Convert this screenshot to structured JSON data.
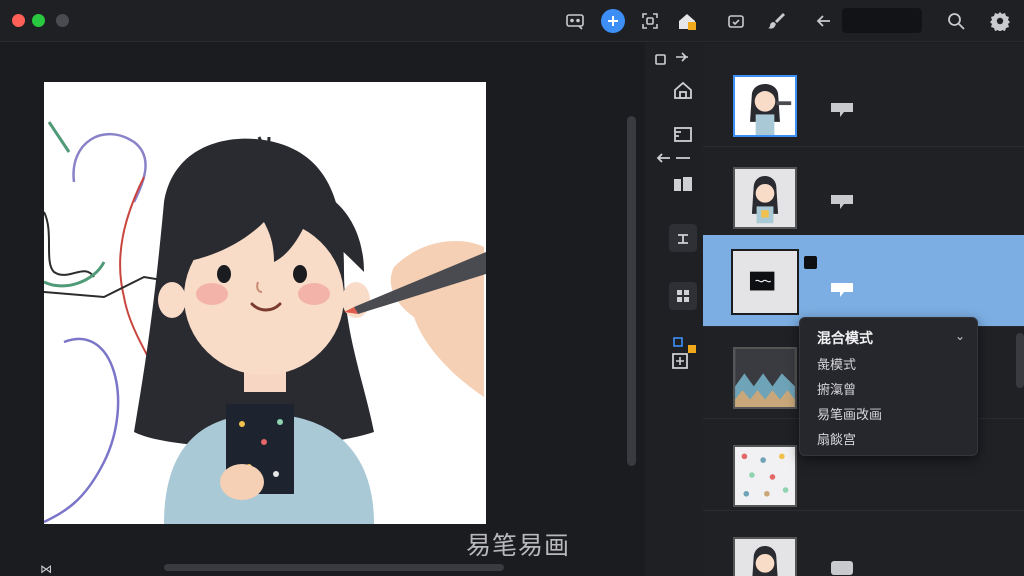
{
  "titlebar": {
    "icons": [
      "screen-share-icon",
      "add-icon",
      "focus-icon",
      "home-layers-icon",
      "crop-icon",
      "brush-icon",
      "back-arrow-icon",
      "search-icon",
      "settings-icon"
    ]
  },
  "canvas": {
    "watermark": "易笔易画"
  },
  "tools": {
    "icons": [
      "swap-icon",
      "home-icon",
      "ruler-icon",
      "transform-icon",
      "stamp-icon",
      "grid-icon",
      "layer-add-icon"
    ]
  },
  "layers": [
    {
      "thumbnail": "girl-drawing-full",
      "selected": false
    },
    {
      "thumbnail": "girl-character",
      "selected": false
    },
    {
      "thumbnail": "signature-patch",
      "selected": true
    },
    {
      "thumbnail": "mountain-pattern",
      "selected": false
    },
    {
      "thumbnail": "dots-pattern",
      "selected": false
    },
    {
      "thumbnail": "girl-small",
      "selected": false
    }
  ],
  "blend_menu": {
    "title": "混合模式",
    "items": [
      "彘模式",
      "捬滊曾",
      "易笔画改画",
      "扇餤宫"
    ]
  },
  "colors": {
    "accent": "#3d8ff5",
    "selected_layer": "#7caee3",
    "background": "#1b1c20"
  }
}
